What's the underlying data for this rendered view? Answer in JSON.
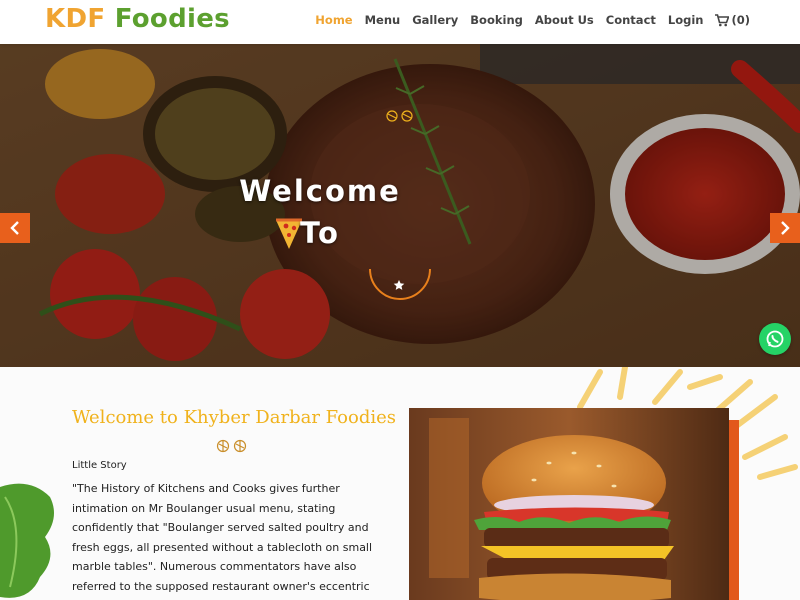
{
  "brand": {
    "part1": "KDF",
    "part2": "Foodies"
  },
  "nav": {
    "items": [
      "Home",
      "Menu",
      "Gallery",
      "Booking",
      "About Us",
      "Contact",
      "Login"
    ],
    "active": "Home",
    "cart_label": "(0)"
  },
  "hero": {
    "title_line1": "Welcome",
    "title_line2": "To",
    "slide_count": 3,
    "active_slide": 1
  },
  "about": {
    "title": "Welcome to Khyber Darbar Foodies",
    "subtitle": "Little Story",
    "paragraph": "\"The History of Kitchens and Cooks gives further intimation on Mr Boulanger usual menu, stating confidently that \"Boulanger served salted poultry and fresh eggs, all presented without a tablecloth on small marble tables\". Numerous commentators have also referred to the supposed restaurant owner's eccentric habit of touting for"
  },
  "colors": {
    "brand_orange": "#f0a431",
    "brand_green": "#5ca02f",
    "accent": "#e8601c",
    "title_gold": "#f0b21c",
    "whatsapp": "#25d366"
  },
  "icons": [
    "cart-icon",
    "chevron-left-icon",
    "chevron-right-icon",
    "whatsapp-icon",
    "pizza-icon",
    "star-icon",
    "ornament-icon"
  ]
}
